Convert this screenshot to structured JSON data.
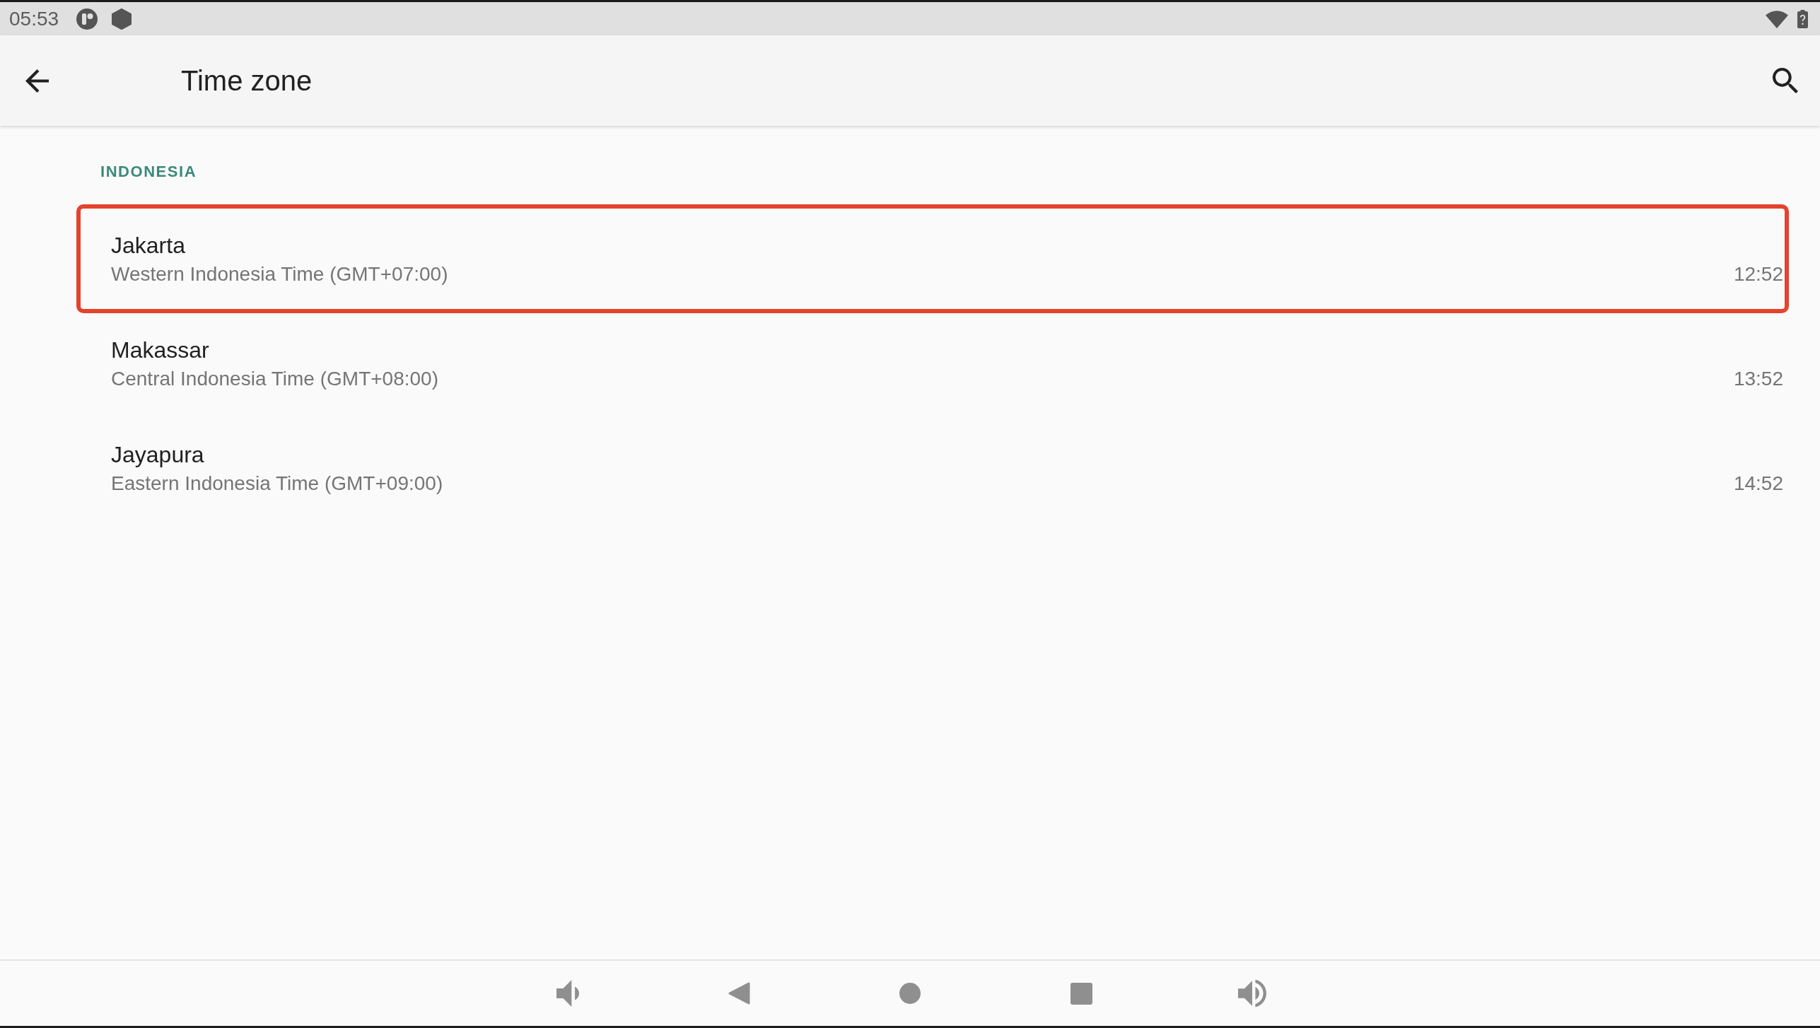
{
  "status_bar": {
    "time": "05:53"
  },
  "app_bar": {
    "title": "Time zone"
  },
  "section": {
    "header": "INDONESIA",
    "rows": [
      {
        "name": "Jakarta",
        "zone": "Western Indonesia Time (GMT+07:00)",
        "time": "12:52",
        "highlighted": true
      },
      {
        "name": "Makassar",
        "zone": "Central Indonesia Time (GMT+08:00)",
        "time": "13:52",
        "highlighted": false
      },
      {
        "name": "Jayapura",
        "zone": "Eastern Indonesia Time (GMT+09:00)",
        "time": "14:52",
        "highlighted": false
      }
    ]
  }
}
